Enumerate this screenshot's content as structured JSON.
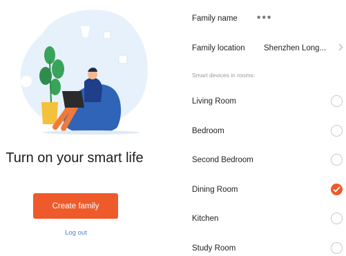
{
  "onboarding": {
    "headline": "Turn on your smart life",
    "create_button": "Create family",
    "logout_link": "Log out"
  },
  "family": {
    "name_label": "Family name",
    "name_value": "***",
    "location_label": "Family location",
    "location_value": "Shenzhen Long..."
  },
  "rooms_section": {
    "caption": "Smart devices in rooms:",
    "rooms": [
      {
        "label": "Living Room",
        "checked": false
      },
      {
        "label": "Bedroom",
        "checked": false
      },
      {
        "label": "Second Bedroom",
        "checked": false
      },
      {
        "label": "Dining Room",
        "checked": true
      },
      {
        "label": "Kitchen",
        "checked": false
      },
      {
        "label": "Study Room",
        "checked": false
      }
    ]
  },
  "colors": {
    "accent": "#ef5a2a",
    "link": "#4a7fd6",
    "blob": "#e6f1fb",
    "beanbag": "#2f64b8",
    "plant": "#3aa35a"
  },
  "icons": [
    "chevron-right-icon",
    "checkmark-icon"
  ]
}
